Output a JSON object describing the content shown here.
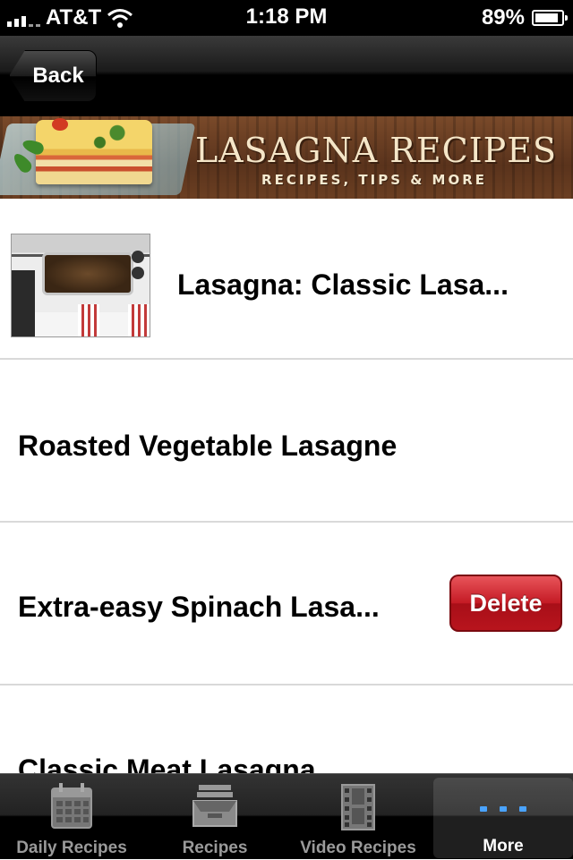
{
  "status_bar": {
    "carrier": "AT&T",
    "time": "1:18 PM",
    "battery": "89%",
    "battery_level": 0.89
  },
  "nav": {
    "back_label": "Back"
  },
  "banner": {
    "title": "LASAGNA RECIPES",
    "subtitle": "RECIPES, TIPS & MORE"
  },
  "list": {
    "rows": [
      {
        "title": "Lasagna: Classic Lasa...",
        "has_thumbnail": true
      },
      {
        "title": "Roasted Vegetable Lasagne",
        "has_thumbnail": false
      },
      {
        "title": "Extra-easy Spinach Lasa...",
        "has_thumbnail": false,
        "delete_label": "Delete"
      },
      {
        "title": "Classic Meat Lasagna",
        "has_thumbnail": false
      }
    ]
  },
  "tabbar": {
    "tabs": [
      {
        "label": "Daily Recipes",
        "icon": "calendar-icon"
      },
      {
        "label": "Recipes",
        "icon": "inbox-tray-icon"
      },
      {
        "label": "Video Recipes",
        "icon": "film-strip-icon"
      },
      {
        "label": "More",
        "icon": "more-dots-icon",
        "selected": true
      }
    ]
  },
  "colors": {
    "delete_red": "#c41a24",
    "selected_tab_dots": "#4aa3ff"
  }
}
